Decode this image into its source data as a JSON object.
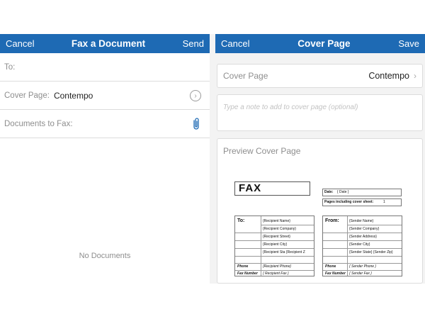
{
  "left_nav": {
    "cancel": "Cancel",
    "title": "Fax a Document",
    "send": "Send"
  },
  "right_nav": {
    "cancel": "Cancel",
    "title": "Cover Page",
    "save": "Save"
  },
  "colors": {
    "navbar": "#1e6ab4",
    "background": "#f3f3f3"
  },
  "left_form": {
    "to_label": "To:",
    "cover_label": "Cover Page:",
    "cover_value": "Contempo",
    "docs_label": "Documents to Fax:",
    "empty_text": "No Documents"
  },
  "right_form": {
    "cover_label": "Cover Page",
    "cover_value": "Contempo",
    "note_placeholder": "Type a note to add to cover page (optional)",
    "preview_title": "Preview Cover Page"
  },
  "fax_preview": {
    "heading": "FAX",
    "date_label": "Date:",
    "date_value": "{ Date }",
    "pages_label": "Pages including cover sheet:",
    "pages_value": "1",
    "to_header": "To:",
    "from_header": "From:",
    "to_fields": [
      "{Recipient Name}",
      "{Recipient Company}",
      "{Recipient Street}",
      "{Recipient City}",
      "{Recipient Sta {Recipient Z"
    ],
    "from_fields": [
      "{Sender Name}",
      "{Sender Company}",
      "{Sender Address}",
      "{Sender City}",
      "{Sender State}   {Sender Zip}"
    ],
    "phone_label": "Phone",
    "phone_to": "{Recipient Phone}",
    "phone_from": "{ Sender Phone }",
    "fax_label": "Fax Number",
    "fax_to": "{ Recipient Fax }",
    "fax_from": "{ Sender Fax }"
  }
}
